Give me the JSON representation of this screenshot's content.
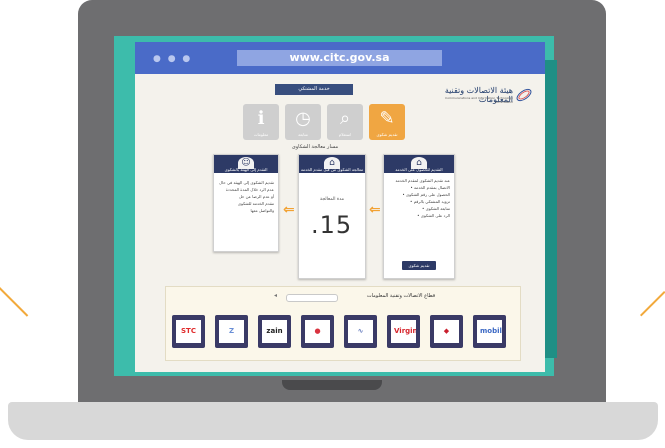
{
  "browser": {
    "url": "www.citc.gov.sa",
    "dots": "● ● ●"
  },
  "page": {
    "logo_text": "هيئة الاتصالات وتقنية المعلومات",
    "logo_subtitle": "Communications and Information Technology Commission",
    "ribbon": "خدمة المشتكي",
    "icons": [
      {
        "name": "complaint-icon",
        "glyph": "✎",
        "label": "تقديم شكوى",
        "active": true
      },
      {
        "name": "search-icon",
        "glyph": "⌕",
        "label": "استعلام",
        "active": false
      },
      {
        "name": "clock-icon",
        "glyph": "◷",
        "label": "متابعة",
        "active": false
      },
      {
        "name": "info-icon",
        "glyph": "ℹ",
        "label": "معلومات",
        "active": false
      }
    ],
    "steps_title": "مسار معالجة الشكاوى",
    "cards": {
      "right": {
        "title": "التقديم للحصول على الخدمة",
        "lines": [
          "عند تقديم الشكوى لمقدم الخدمة",
          "• الاتصال بمقدم الخدمة",
          "• الحصول على رقم الشكوى",
          "• تزويد المشتكي بالرقم",
          "• متابعة الشكوى",
          "• الرد على الشكوى"
        ],
        "button": "تقديم شكوى"
      },
      "middle": {
        "title": "معالجة الشكوى من قبل مقدم الخدمة",
        "caption": "مدة المعالجة",
        "number": ".15"
      },
      "left": {
        "title": "التقدم إلى الهيئة بالشكوى",
        "lines": [
          "تقديم الشكوى إلى الهيئة في حال",
          "عدم الرد خلال المدة المحددة",
          "أو عدم الرضا عن حل",
          "مقدم الخدمة للشكوى",
          "والتواصل معها"
        ]
      }
    },
    "logos_section": {
      "title": "قطاع الاتصالات وتقنية المعلومات",
      "search_placeholder": "",
      "providers": [
        {
          "name": "provider-logo-1",
          "mark": "STC",
          "color": "#e0292a"
        },
        {
          "name": "provider-logo-2",
          "mark": "Z",
          "color": "#6a8fd6"
        },
        {
          "name": "provider-logo-3",
          "mark": "zain",
          "color": "#222222"
        },
        {
          "name": "provider-logo-4",
          "mark": "●",
          "color": "#d9333f"
        },
        {
          "name": "provider-logo-5",
          "mark": "∿",
          "color": "#6a7fbf"
        },
        {
          "name": "provider-logo-6",
          "mark": "Virgin",
          "color": "#d6252c"
        },
        {
          "name": "provider-logo-7",
          "mark": "◆",
          "color": "#c91f2e"
        },
        {
          "name": "provider-logo-8",
          "mark": "mobily",
          "color": "#3b68c4"
        }
      ]
    }
  },
  "colors": {
    "screen_teal": "#3dbcab",
    "browser_blue": "#4a6bc8",
    "navy": "#2d3a66",
    "accent_orange": "#f2a233",
    "laptop_gray": "#6e6e70"
  }
}
